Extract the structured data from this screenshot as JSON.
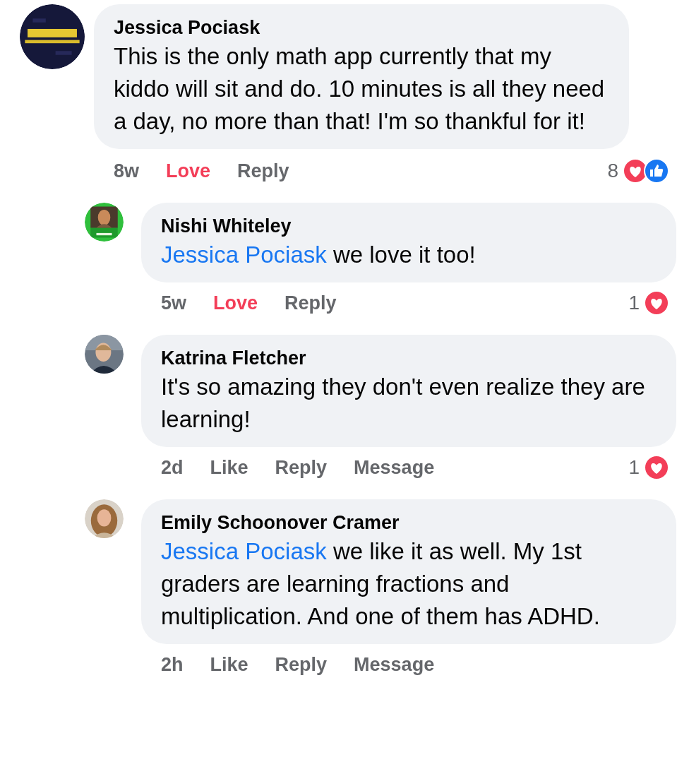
{
  "comments": [
    {
      "author": "Jessica Pociask",
      "text": "This is the only math app currently that my kiddo will sit and do.  10 minutes is all they need a day, no more than that!  I'm so thankful for it!",
      "time": "8w",
      "reaction": {
        "label": "Love",
        "active": true
      },
      "actions": [
        "Reply"
      ],
      "reaction_count": "8",
      "reaction_icons": [
        {
          "kind": "love"
        },
        {
          "kind": "like"
        }
      ],
      "replies": [
        {
          "author": "Nishi Whiteley",
          "mention": "Jessica Pociask",
          "text": " we love it too!",
          "time": "5w",
          "reaction": {
            "label": "Love",
            "active": true
          },
          "actions": [
            "Reply"
          ],
          "reaction_count": "1",
          "reaction_icons": [
            {
              "kind": "love"
            }
          ]
        },
        {
          "author": "Katrina Fletcher",
          "text": "It's so amazing they don't even realize they are learning!",
          "time": "2d",
          "reaction": {
            "label": "Like",
            "active": false
          },
          "actions": [
            "Reply",
            "Message"
          ],
          "reaction_count": "1",
          "reaction_icons": [
            {
              "kind": "love"
            }
          ]
        },
        {
          "author": "Emily Schoonover Cramer",
          "mention": "Jessica Pociask",
          "text": " we like it as well. My 1st graders are learning fractions and multiplication. And one of them has ADHD.",
          "time": "2h",
          "reaction": {
            "label": "Like",
            "active": false
          },
          "actions": [
            "Reply",
            "Message"
          ]
        }
      ]
    }
  ]
}
